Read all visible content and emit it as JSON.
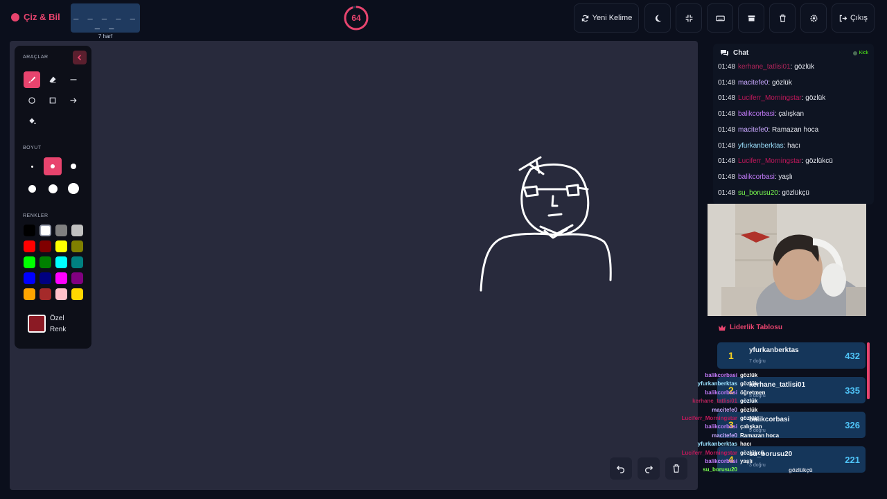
{
  "app": {
    "title": "Çiz & Bil"
  },
  "word": {
    "mask": "_ _ _ _ _ _ _",
    "length_label": "7 harf"
  },
  "timer": {
    "value": "64",
    "progress": 0.95
  },
  "toolbar": {
    "new_word_label": "Yeni Kelime",
    "exit_label": "Çıkış"
  },
  "tools_panel": {
    "tools_title": "ARAÇLAR",
    "size_title": "BOYUT",
    "colors_title": "RENKLER",
    "custom_color_label": "Özel Renk",
    "custom_color": "#8b1a24",
    "colors": [
      "#000000",
      "#ffffff",
      "#808080",
      "#c0c0c0",
      "#ff0000",
      "#800000",
      "#ffff00",
      "#808000",
      "#00ff00",
      "#008000",
      "#00ffff",
      "#008080",
      "#0000ff",
      "#000080",
      "#ff00ff",
      "#800080",
      "#ffa500",
      "#a52a2a",
      "#ffc0cb",
      "#ffd700"
    ],
    "selected_color": "#ffffff",
    "selected_size_index": 1
  },
  "chat": {
    "title": "Chat",
    "platform": "Kick",
    "messages": [
      {
        "time": "01:48",
        "user": "kerhane_tatlisi01",
        "color": "#b0245a",
        "text": ": gözlük"
      },
      {
        "time": "01:48",
        "user": "macitefe0",
        "color": "#c9a8ff",
        "text": ": gözlük"
      },
      {
        "time": "01:48",
        "user": "Luciferr_Morningstar",
        "color": "#c2185b",
        "text": ": gözlük"
      },
      {
        "time": "01:48",
        "user": "balikcorbasi",
        "color": "#c77dff",
        "text": ": çalışkan"
      },
      {
        "time": "01:48",
        "user": "macitefe0",
        "color": "#c9a8ff",
        "text": ": Ramazan hoca"
      },
      {
        "time": "01:48",
        "user": "yfurkanberktas",
        "color": "#9de2ff",
        "text": ": hacı"
      },
      {
        "time": "01:48",
        "user": "Luciferr_Morningstar",
        "color": "#c2185b",
        "text": ": gözlükcü"
      },
      {
        "time": "01:48",
        "user": "balikcorbasi",
        "color": "#c77dff",
        "text": ": yaşlı"
      },
      {
        "time": "01:48",
        "user": "su_borusu20",
        "color": "#7cff4f",
        "text": ": gözlükçü"
      }
    ]
  },
  "leaderboard": {
    "title": "Liderlik Tablosu",
    "rows": [
      {
        "rank": "1",
        "name": "yfurkanberktas",
        "sub": "7 doğru",
        "score": "432"
      },
      {
        "rank": "2",
        "name": "kerhane_tatlisi01",
        "sub": "5 doğru",
        "score": "335"
      },
      {
        "rank": "3",
        "name": "balikcorbasi",
        "sub": "5 doğru",
        "score": "326"
      },
      {
        "rank": "4",
        "name": "su_borusu20",
        "sub": "3 doğru",
        "score": "221"
      }
    ]
  },
  "overlay_chat": [
    {
      "user": "balikcorbasi",
      "color": "#c77dff",
      "text": "gözlük"
    },
    {
      "user": "yfurkanberktas",
      "color": "#9de2ff",
      "text": "gözlük"
    },
    {
      "user": "balikcorbasi",
      "color": "#c77dff",
      "text": "öğretmen"
    },
    {
      "user": "kerhane_tatlisi01",
      "color": "#b0245a",
      "text": "gözlük"
    },
    {
      "user": "macitefe0",
      "color": "#c9a8ff",
      "text": "gözlük"
    },
    {
      "user": "Luciferr_Morningstar",
      "color": "#c2185b",
      "text": "gözlük"
    },
    {
      "user": "balikcorbasi",
      "color": "#c77dff",
      "text": "çalışkan"
    },
    {
      "user": "macitefe0",
      "color": "#c9a8ff",
      "text": "Ramazan hoca"
    },
    {
      "user": "yfurkanberktas",
      "color": "#9de2ff",
      "text": "hacı"
    },
    {
      "user": "Luciferr_Morningstar",
      "color": "#c2185b",
      "text": "gözlükcü"
    },
    {
      "user": "balikcorbasi",
      "color": "#c77dff",
      "text": "yaşlı"
    },
    {
      "user": "su_borusu20",
      "color": "#7cff4f",
      "text": ""
    }
  ],
  "overlay_last": "gözlükçü"
}
